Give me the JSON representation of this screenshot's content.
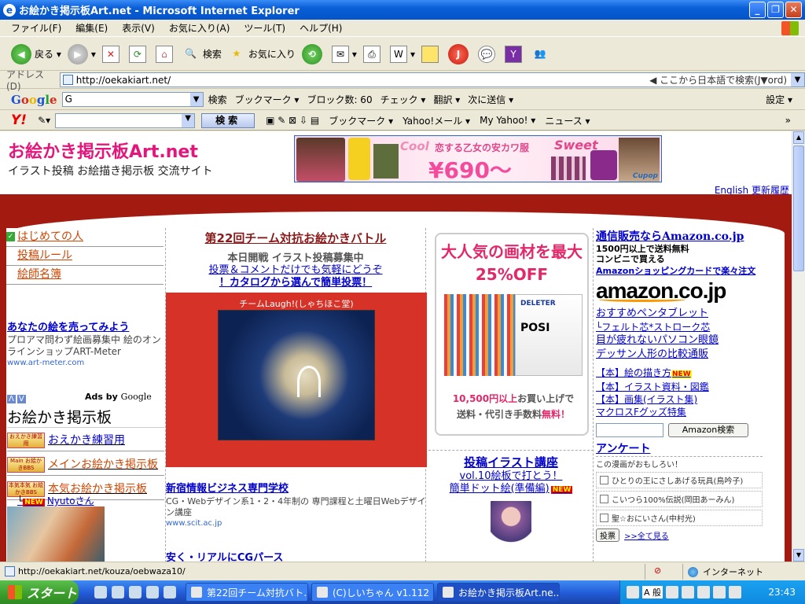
{
  "window": {
    "title": "お絵かき掲示板Art.net - Microsoft Internet Explorer",
    "buttons": [
      "_",
      "❐",
      "✕"
    ]
  },
  "menubar": [
    "ファイル(F)",
    "編集(E)",
    "表示(V)",
    "お気に入り(A)",
    "ツール(T)",
    "ヘルプ(H)"
  ],
  "toolbar": {
    "back_label": "戻る",
    "search_label": "検索",
    "favorites_label": "お気に入り"
  },
  "address": {
    "label": "アドレス(D)",
    "url": "http://oekakiart.net/",
    "hint": "◀ ここから日本語で検索(J▼ord)"
  },
  "googlebar": {
    "logo": [
      "G",
      "o",
      "o",
      "g",
      "l",
      "e"
    ],
    "input_value": "G",
    "items": [
      "検索",
      "ブックマーク ▾",
      "ブロック数: 60",
      "チェック ▾",
      "翻訳 ▾",
      "次に送信 ▾",
      "設定 ▾"
    ]
  },
  "yahoobar": {
    "logo": "Y!",
    "search_button": "検索",
    "items": [
      "ブックマーク ▾",
      "Yahoo!メール ▾",
      "My Yahoo! ▾",
      "ニュース ▾",
      "»"
    ]
  },
  "site": {
    "title": "お絵かき掲示板Art.net",
    "subtitle": "イラスト投稿 お絵描き掲示板 交流サイト",
    "links": [
      "English",
      "更新履歴"
    ]
  },
  "banner": {
    "cool": "Cool",
    "copy": "恋する乙女の安カワ服",
    "sweet": "Sweet",
    "price": "¥690〜",
    "brand": "Cupop"
  },
  "left_nav": [
    "はじめての人",
    "投稿ルール",
    "絵師名簿"
  ],
  "left_ad": {
    "title": "あなたの絵を売ってみよう",
    "desc": "プロアマ問わず絵画募集中 絵のオンラインショップART-Meter",
    "url": "www.art-meter.com"
  },
  "adsby": {
    "prefix": "Ads by",
    "name": "Google"
  },
  "oekaki_header": "お絵かき掲示板",
  "bbs_items": [
    {
      "icon": "おえかき練習用",
      "label": "おえかき練習用"
    },
    {
      "icon": "Main お絵かきBBS",
      "label": "メインお絵かき掲示板"
    },
    {
      "icon": "本気本気 お絵かきBBS",
      "label": "本気お絵かき掲示板"
    }
  ],
  "new_entry": {
    "badge": "NEW",
    "name": "Nyutoさん"
  },
  "contest": {
    "title": "第22回チーム対抗お絵かきバトル",
    "status": "本日開戦 イラスト投稿募集中",
    "line1": "投票＆コメントだけでも気軽にどうぞ",
    "line2": "！カタログから選んで簡単投票！",
    "team": "チームLaugh!(しゃちほこ堂)"
  },
  "mid_ad": {
    "title": "新宿情報ビジネス専門学校",
    "desc": "CG・Webデザイン系1・2・4年制の 専門課程と土曜日Webデザイン講座",
    "url": "www.scit.ac.jp"
  },
  "mid_ad2": "安く・リアルにCGパース",
  "gazai": {
    "headline": "大人気の画材を最大25%OFF",
    "tag1": "DELETER",
    "tag2": "POSI",
    "foot1_strong": "10,500円以上",
    "foot1_rest": "お買い上げで",
    "foot2_rest": "送料・代引き手数料",
    "foot2_strong": "無料！"
  },
  "kouza": {
    "title": "投稿イラスト講座",
    "line1": "vol.10絵板で打とう！",
    "line2": "簡単ドット絵(準備編)",
    "badge": "NEW"
  },
  "amazon": {
    "title": "通信販売ならAmazon.co.jp",
    "line1": "1500円以上で送料無料",
    "line2": "コンビニで買える",
    "card_link": "Amazonショッピングカード",
    "card_rest": "で楽々注文",
    "logo": "amazon.co.jp",
    "links": [
      "おすすめペンタブレット",
      "└フェルト芯*ストローク芯",
      "目が疲れないパソコン眼鏡",
      "デッサン人形の比較通販"
    ],
    "books": [
      "【本】絵の描き方",
      "【本】イラスト資料・図鑑",
      "【本】画集(イラスト集)",
      "マクロスFグッズ特集"
    ],
    "books_new": "NEW",
    "search_button": "Amazon検索"
  },
  "poll": {
    "title": "アンケート",
    "sub": "この漫画がおもしろい！",
    "options": [
      "ひとりの王にさしあげる玩具(鳥吟子)",
      "こいつら100%伝説(岡田あーみん)",
      "聖☆おにいさん(中村光)"
    ],
    "vote_button": "投票",
    "all_link": ">>全て見る"
  },
  "statusbar": {
    "url": "http://oekakiart.net/kouza/oebwaza10/",
    "zone": "インターネット"
  },
  "taskbar": {
    "start": "スタート",
    "tasks": [
      "第22回チーム対抗バト...",
      "(C)しいちゃん v1.112 し...",
      "お絵かき掲示板Art.ne..."
    ],
    "ime": "A 般",
    "clock": "23:43"
  }
}
